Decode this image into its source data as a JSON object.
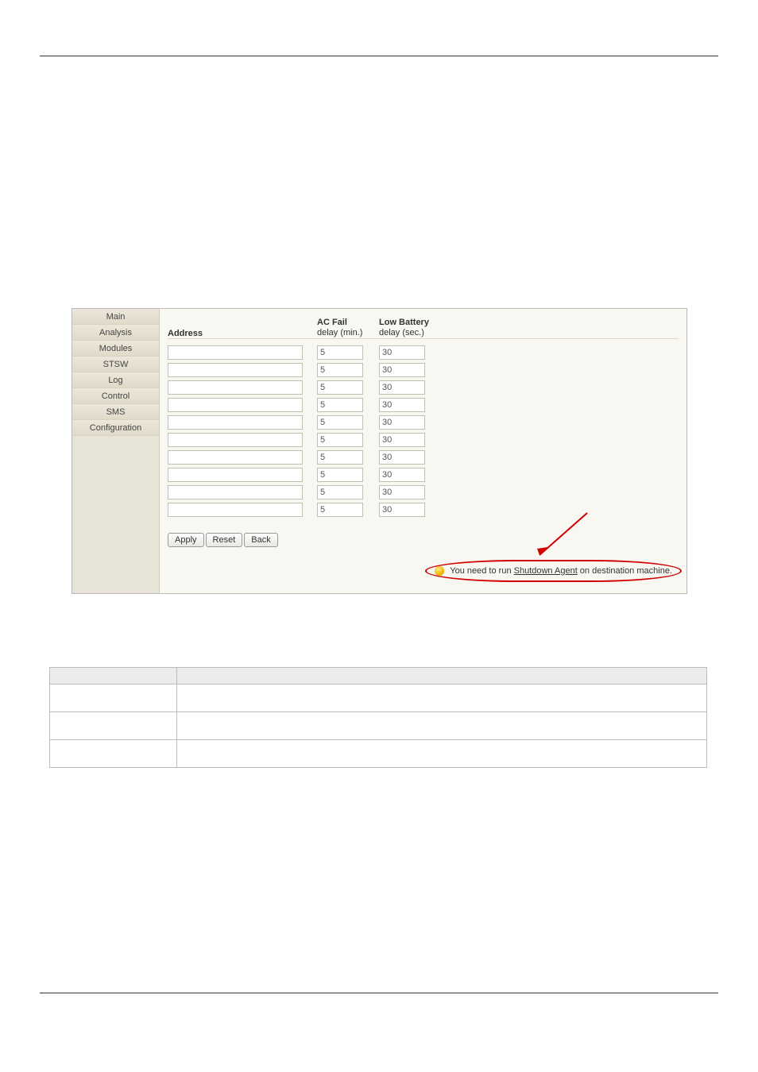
{
  "sidebar": {
    "items": [
      {
        "label": "Main"
      },
      {
        "label": "Analysis"
      },
      {
        "label": "Modules"
      },
      {
        "label": "STSW"
      },
      {
        "label": "Log"
      },
      {
        "label": "Control"
      },
      {
        "label": "SMS"
      },
      {
        "label": "Configuration"
      }
    ]
  },
  "headers": {
    "address": "Address",
    "ac_bold": "AC Fail",
    "ac_sub": "delay (min.)",
    "lb_bold": "Low Battery",
    "lb_sub": "delay (sec.)"
  },
  "rows": [
    {
      "addr": "",
      "ac": "5",
      "lb": "30"
    },
    {
      "addr": "",
      "ac": "5",
      "lb": "30"
    },
    {
      "addr": "",
      "ac": "5",
      "lb": "30"
    },
    {
      "addr": "",
      "ac": "5",
      "lb": "30"
    },
    {
      "addr": "",
      "ac": "5",
      "lb": "30"
    },
    {
      "addr": "",
      "ac": "5",
      "lb": "30"
    },
    {
      "addr": "",
      "ac": "5",
      "lb": "30"
    },
    {
      "addr": "",
      "ac": "5",
      "lb": "30"
    },
    {
      "addr": "",
      "ac": "5",
      "lb": "30"
    },
    {
      "addr": "",
      "ac": "5",
      "lb": "30"
    }
  ],
  "buttons": {
    "apply": "Apply",
    "reset": "Reset",
    "back": "Back"
  },
  "note": {
    "prefix": "You need to run ",
    "link": "Shutdown Agent",
    "suffix": " on destination machine."
  },
  "desc_table": {
    "head_item": "",
    "head_desc": "",
    "rows": [
      {
        "item": "",
        "desc": ""
      },
      {
        "item": "",
        "desc": ""
      },
      {
        "item": "",
        "desc": ""
      }
    ]
  }
}
